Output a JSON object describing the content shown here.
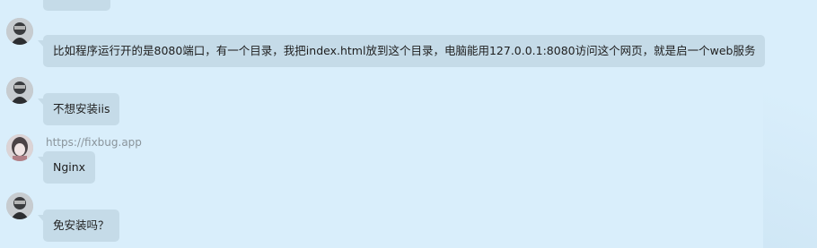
{
  "messages": [
    {
      "sender": "",
      "text": "",
      "partial": true
    },
    {
      "sender": "",
      "text": "比如程序运行开的是8080端口，有一个目录，我把index.html放到这个目录，电脑能用127.0.0.1:8080访问这个网页，就是启一个web服务"
    },
    {
      "sender": "",
      "text": "不想安装iis"
    },
    {
      "sender": "https://fixbug.app",
      "text": "Nginx"
    },
    {
      "sender": "",
      "text": "免安装吗？"
    }
  ],
  "colors": {
    "background": "#d9eefb",
    "bubble": "#c5dbe8",
    "text": "#1e1e1e",
    "sender_name": "#8a949b"
  },
  "icons": {
    "user_avatar": "user-avatar-icon",
    "sender_avatar": "sender-avatar-icon"
  }
}
